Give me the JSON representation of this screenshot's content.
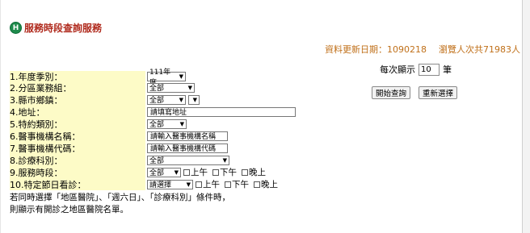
{
  "header": {
    "logo_letter": "H",
    "title": "服務時段查詢服務"
  },
  "meta": {
    "update_label": "資料更新日期：1090218",
    "views_label": "瀏覽人次共71983人"
  },
  "per_page": {
    "label": "每次顯示",
    "value": "10",
    "unit": "筆"
  },
  "buttons": {
    "search": "開始查詢",
    "reset": "重新選擇"
  },
  "form": {
    "rows": [
      {
        "label": "1.年度季別："
      },
      {
        "label": "2.分區業務組："
      },
      {
        "label": "3.縣市鄉鎮："
      },
      {
        "label": "4.地址："
      },
      {
        "label": "5.特約類別："
      },
      {
        "label": "6.醫事機構名稱："
      },
      {
        "label": "7.醫事機構代碼："
      },
      {
        "label": "8.診療科別："
      },
      {
        "label": "9.服務時段："
      },
      {
        "label": "10.特定節日看診："
      }
    ],
    "year": "111年度",
    "district": "全部",
    "county": "全部",
    "town": "",
    "address_placeholder": "請填寫地址",
    "contract_type": "全部",
    "name_placeholder": "請輸入醫事機構名稱",
    "code_placeholder": "請輸入醫事機構代碼",
    "department": "全部",
    "service_period": "全部",
    "holiday": "請選擇",
    "checks": [
      "上午",
      "下午",
      "晚上"
    ]
  },
  "notes": [
    "若同時選擇「地區醫院」、「週六日」、「診療科別」條件時，",
    "則顯示有開診之地區醫院名單。"
  ]
}
